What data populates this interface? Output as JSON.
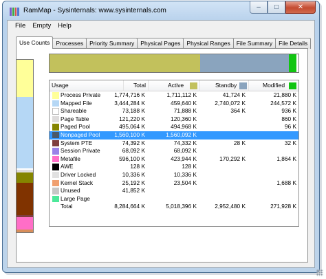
{
  "window": {
    "title": "RamMap - Sysinternals: www.sysinternals.com",
    "icon_colors": [
      "#7a5cc8",
      "#45a845",
      "#d95050",
      "#5079d0"
    ],
    "buttons": {
      "minimize": "–",
      "maximize": "□",
      "close": "✕"
    }
  },
  "menu": {
    "items": [
      "File",
      "Empty",
      "Help"
    ]
  },
  "tabs": [
    "Use Counts",
    "Processes",
    "Priority Summary",
    "Physical Pages",
    "Physical Ranges",
    "File Summary",
    "File Details"
  ],
  "active_tab": 0,
  "top_bar": [
    {
      "name": "Active",
      "fraction": 0.605,
      "color": "#c2c15c"
    },
    {
      "name": "Standby",
      "fraction": 0.355,
      "color": "#8aa4be"
    },
    {
      "name": "Modified",
      "fraction": 0.033,
      "color": "#11c511"
    }
  ],
  "side_bar": [
    {
      "name": "Process Private",
      "fraction": 0.214,
      "color": "#ffff99"
    },
    {
      "name": "Mapped File",
      "fraction": 0.416,
      "color": "#b5d7f5"
    },
    {
      "name": "Shareable",
      "fraction": 0.009,
      "color": "#ffffff"
    },
    {
      "name": "Page Table",
      "fraction": 0.015,
      "color": "#dedcdc"
    },
    {
      "name": "Paged Pool",
      "fraction": 0.06,
      "color": "#858500"
    },
    {
      "name": "Nonpaged Pool",
      "fraction": 0.188,
      "color": "#803300"
    },
    {
      "name": "System PTE",
      "fraction": 0.009,
      "color": "#7e3e3e"
    },
    {
      "name": "Metafile",
      "fraction": 0.072,
      "color": "#ff6ec7"
    },
    {
      "name": "Kernel Stack",
      "fraction": 0.017,
      "color": "#d88e5a"
    }
  ],
  "table": {
    "columns": [
      "Usage",
      "Total",
      "Active",
      "Standby",
      "Modified"
    ],
    "header_swatches": {
      "Active": "#c2c15c",
      "Standby": "#8aa4be",
      "Modified": "#11c511"
    },
    "selected_row": 6,
    "rows": [
      {
        "name": "Process Private",
        "color": "#ffff99",
        "total": "1,774,716 K",
        "active": "1,711,112 K",
        "standby": "41,724 K",
        "modified": "21,880 K"
      },
      {
        "name": "Mapped File",
        "color": "#b5d7f5",
        "total": "3,444,284 K",
        "active": "459,640 K",
        "standby": "2,740,072 K",
        "modified": "244,572 K"
      },
      {
        "name": "Shareable",
        "color": "#ffffff",
        "total": "73,188 K",
        "active": "71,888 K",
        "standby": "364 K",
        "modified": "936 K"
      },
      {
        "name": "Page Table",
        "color": "#dedcdc",
        "total": "121,220 K",
        "active": "120,360 K",
        "standby": "",
        "modified": "860 K"
      },
      {
        "name": "Paged Pool",
        "color": "#858500",
        "total": "495,064 K",
        "active": "494,968 K",
        "standby": "",
        "modified": "96 K"
      },
      {
        "name": "Nonpaged Pool",
        "color": "#4a5a6a",
        "total": "1,560,100 K",
        "active": "1,560,092 K",
        "standby": "",
        "modified": ""
      },
      {
        "name": "System PTE",
        "color": "#7e3e3e",
        "total": "74,392 K",
        "active": "74,332 K",
        "standby": "28 K",
        "modified": "32 K"
      },
      {
        "name": "Session Private",
        "color": "#9a82e8",
        "total": "68,092 K",
        "active": "68,092 K",
        "standby": "",
        "modified": ""
      },
      {
        "name": "Metafile",
        "color": "#ff6ec7",
        "total": "596,100 K",
        "active": "423,944 K",
        "standby": "170,292 K",
        "modified": "1,864 K"
      },
      {
        "name": "AWE",
        "color": "#000000",
        "total": "128 K",
        "active": "128 K",
        "standby": "",
        "modified": ""
      },
      {
        "name": "Driver Locked",
        "color": "#e1e1e1",
        "total": "10,336 K",
        "active": "10,336 K",
        "standby": "",
        "modified": ""
      },
      {
        "name": "Kernel Stack",
        "color": "#f0a070",
        "total": "25,192 K",
        "active": "23,504 K",
        "standby": "",
        "modified": "1,688 K"
      },
      {
        "name": "Unused",
        "color": "#c7c7c7",
        "total": "41,852 K",
        "active": "",
        "standby": "",
        "modified": ""
      },
      {
        "name": "Large Page",
        "color": "#4de89a",
        "total": "",
        "active": "",
        "standby": "",
        "modified": ""
      },
      {
        "name": "Total",
        "color": "",
        "total": "8,284,664 K",
        "active": "5,018,396 K",
        "standby": "2,952,480 K",
        "modified": "271,928 K"
      }
    ]
  }
}
